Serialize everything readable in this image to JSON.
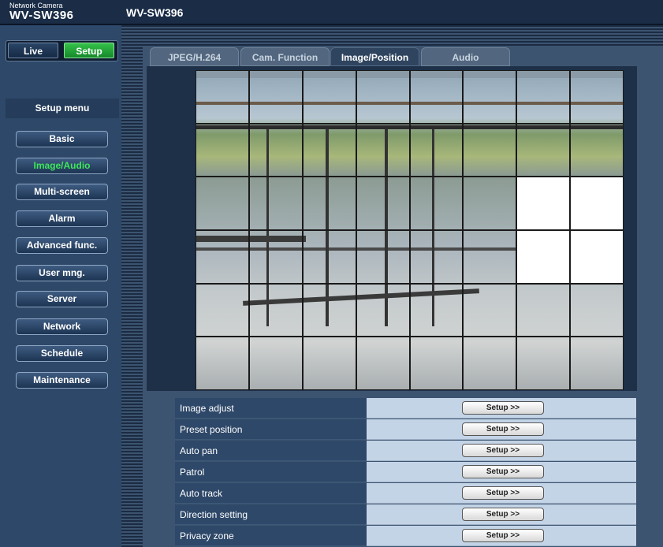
{
  "header": {
    "brand_line1": "Network Camera",
    "brand_line2": "WV-SW396",
    "model": "WV-SW396"
  },
  "mode_buttons": {
    "live": "Live",
    "setup": "Setup"
  },
  "sidebar": {
    "title": "Setup menu",
    "items": [
      {
        "label": "Basic"
      },
      {
        "label": "Image/Audio"
      },
      {
        "label": "Multi-screen"
      },
      {
        "label": "Alarm"
      },
      {
        "label": "Advanced func."
      },
      {
        "label": "User mng."
      },
      {
        "label": "Server"
      },
      {
        "label": "Network"
      },
      {
        "label": "Schedule"
      },
      {
        "label": "Maintenance"
      }
    ],
    "active_item": "Image/Audio"
  },
  "tabs": [
    {
      "label": "JPEG/H.264"
    },
    {
      "label": "Cam. Function"
    },
    {
      "label": "Image/Position"
    },
    {
      "label": "Audio"
    }
  ],
  "active_tab": "Image/Position",
  "settings": {
    "button_label": "Setup >>",
    "rows": [
      {
        "label": "Image adjust"
      },
      {
        "label": "Preset position"
      },
      {
        "label": "Auto pan"
      },
      {
        "label": "Patrol"
      },
      {
        "label": "Auto track"
      },
      {
        "label": "Direction setting"
      },
      {
        "label": "Privacy zone"
      }
    ]
  },
  "colors": {
    "active_green": "#3ee65a",
    "panel_blue": "#2e4869",
    "cell_light": "#c4d4e7"
  }
}
